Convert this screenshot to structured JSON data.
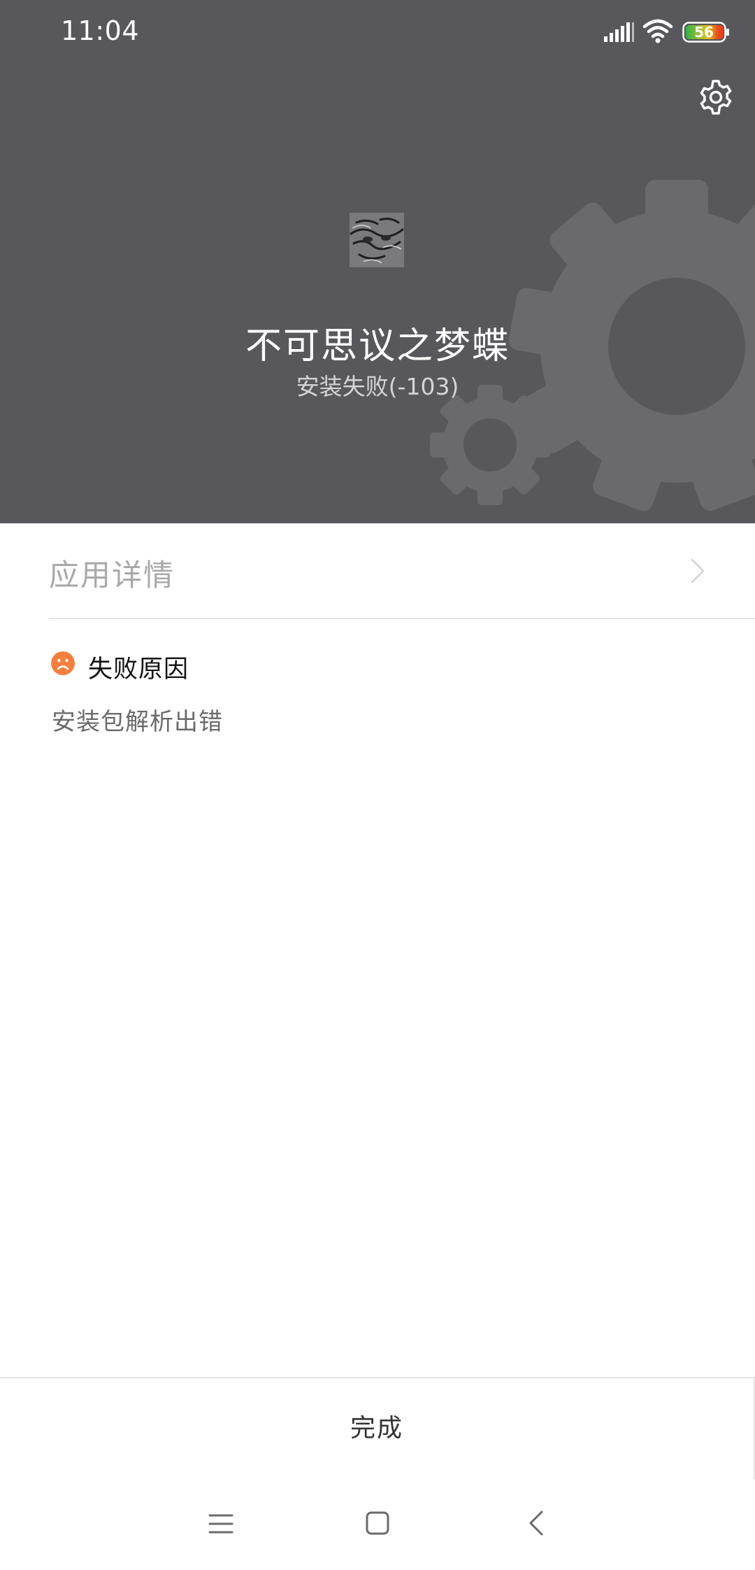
{
  "status_bar": {
    "time": "11:04",
    "battery": "56",
    "icons": [
      "signal-icon",
      "wifi-icon",
      "battery-icon"
    ]
  },
  "header": {
    "app_name": "不可思议之梦蝶",
    "install_status": "安装失败(-103)",
    "settings_icon": "gear-icon",
    "background_color": "#58575c"
  },
  "details": {
    "label": "应用详情",
    "icon": "chevron-right-icon"
  },
  "failure": {
    "icon": "sad-face-icon",
    "icon_color": "#f5803e",
    "title": "失败原因",
    "reason": "安装包解析出错"
  },
  "footer": {
    "done_label": "完成"
  },
  "nav_bar": {
    "icons": [
      "menu-icon",
      "home-icon",
      "back-icon"
    ]
  }
}
